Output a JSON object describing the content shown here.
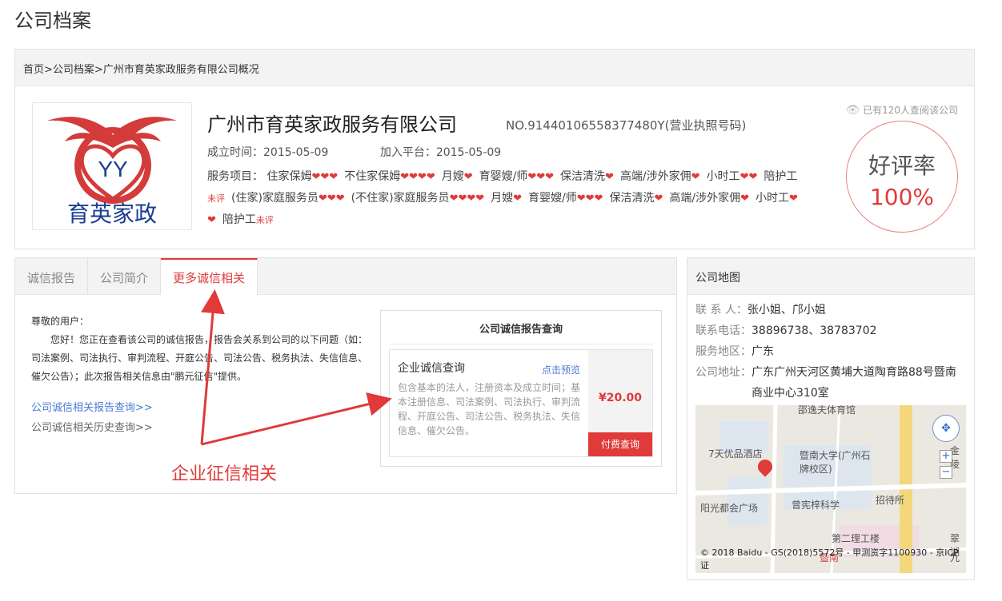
{
  "page": {
    "title": "公司档案"
  },
  "breadcrumb": "首页>公司档案>广州市育英家政服务有限公司概况",
  "company": {
    "logo_text": "育英家政",
    "logo_initials": "YY",
    "name": "广州市育英家政服务有限公司",
    "reg_no": "NO.91440106558377480Y(营业执照号码)",
    "founded": "成立时间：2015-05-09",
    "joined": "加入平台：2015-05-09",
    "views": "已有120人查阅该公司",
    "rating_label": "好评率",
    "rating_value": "100%",
    "services_label": "服务项目：",
    "services": [
      {
        "name": "住家保姆",
        "hearts": "❤❤❤"
      },
      {
        "name": "不住家保姆",
        "hearts": "❤❤❤❤"
      },
      {
        "name": "月嫂",
        "hearts": "❤"
      },
      {
        "name": "育婴嫂/师",
        "hearts": "❤❤❤"
      },
      {
        "name": "保洁清洗",
        "hearts": "❤"
      },
      {
        "name": "高端/涉外家佣",
        "hearts": "❤"
      },
      {
        "name": "小时工",
        "hearts": "❤❤"
      },
      {
        "name": "陪护工",
        "unrated": "未评"
      },
      {
        "name": "(住家)家庭服务员",
        "hearts": "❤❤❤"
      },
      {
        "name": "(不住家)家庭服务员",
        "hearts": "❤❤❤❤"
      },
      {
        "name": "月嫂",
        "hearts": "❤"
      },
      {
        "name": "育婴嫂/师",
        "hearts": "❤❤❤"
      },
      {
        "name": "保洁清洗",
        "hearts": "❤"
      },
      {
        "name": "高端/涉外家佣",
        "hearts": "❤"
      },
      {
        "name": "小时工",
        "hearts": "❤❤"
      },
      {
        "name": "陪护工",
        "unrated": "未评"
      }
    ]
  },
  "tabs": [
    "诚信报告",
    "公司简介",
    "更多诚信相关"
  ],
  "intro": {
    "greeting": "尊敬的用户：",
    "body": "您好！您正在查看该公司的诚信报告，报告会关系到公司的以下问题（如：司法案例、司法执行、审判流程、开庭公告、司法公告、税务执法、失信信息、催欠公告）；此次报告相关信息由\"鹏元征信\"提供。",
    "link1": "公司诚信相关报告查询>>",
    "link2": "公司诚信相关历史查询>>"
  },
  "query": {
    "title": "公司诚信报告查询",
    "card_title": "企业诚信查询",
    "preview": "点击预览",
    "desc": "包含基本的法人，注册资本及成立时间；基本注册信息、司法案例、司法执行、审判流程、开庭公告、司法公告、税务执法、失信信息、催欠公告。",
    "price": "¥20.00",
    "pay_button": "付费查询"
  },
  "annotation": "企业征信相关",
  "sidebar": {
    "title": "公司地图",
    "contact_label": "联 系 人：",
    "contact": "张小姐、邝小姐",
    "phone_label": "联系电话：",
    "phone": "38896738、38783702",
    "area_label": "服务地区：",
    "area": "广东",
    "address_label": "公司地址：",
    "address": "广东广州天河区黄埔大道陶育路88号暨南商业中心310室"
  },
  "map": {
    "labels": [
      "邵逸夫体育馆",
      "7天优品酒店",
      "暨南大学(广州石牌校区)",
      "阳光都会广场",
      "曾宪梓科学",
      "招待所",
      "第二理工楼",
      "暨南",
      "金陵",
      "翠湖",
      "九"
    ],
    "copyright": "© 2018 Baidu - GS(2018)5572号 - 甲测资字1100930 - 京ICP证"
  }
}
